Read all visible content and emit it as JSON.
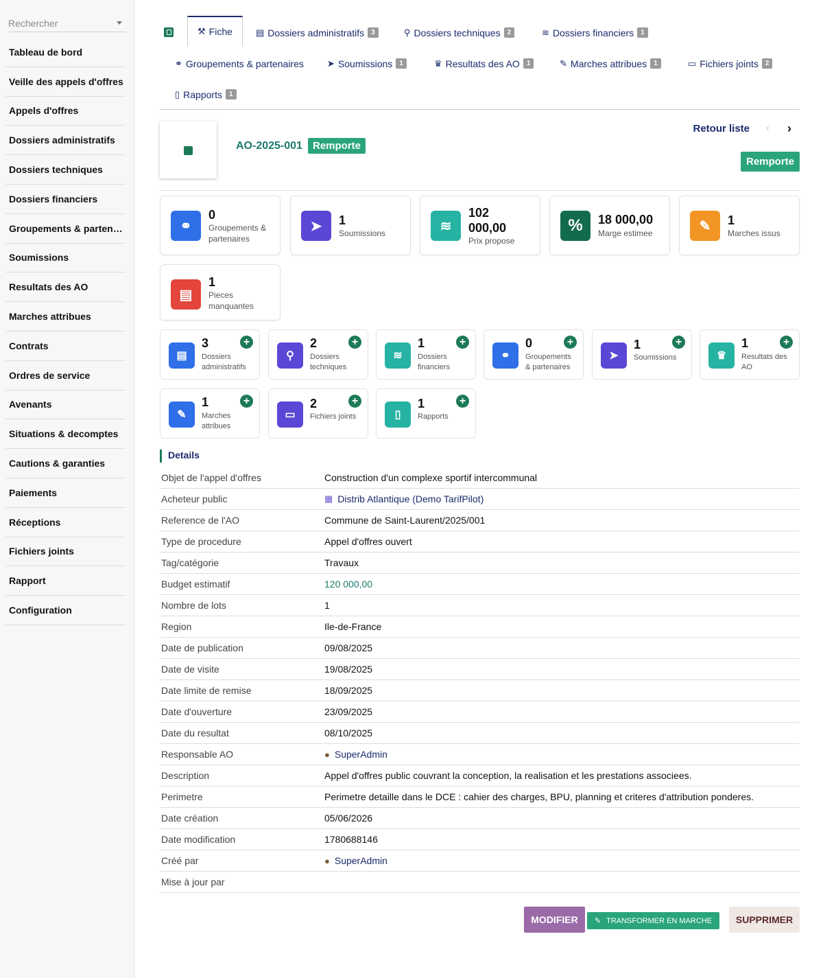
{
  "sidebar": {
    "search_placeholder": "Rechercher",
    "items": [
      "Tableau de bord",
      "Veille des appels d'offres",
      "Appels d'offres",
      "Dossiers administratifs",
      "Dossiers techniques",
      "Dossiers financiers",
      "Groupements & partenaires",
      "Soumissions",
      "Resultats des AO",
      "Marches attribues",
      "Contrats",
      "Ordres de service",
      "Avenants",
      "Situations & decomptes",
      "Cautions & garanties",
      "Paiements",
      "Réceptions",
      "Fichiers joints",
      "Rapport",
      "Configuration"
    ]
  },
  "tabs": [
    {
      "label": "Fiche",
      "icon": "wrench-icon",
      "badge": ""
    },
    {
      "label": "Dossiers administratifs",
      "icon": "id-card-icon",
      "badge": "3"
    },
    {
      "label": "Dossiers techniques",
      "icon": "compass-icon",
      "badge": "2"
    },
    {
      "label": "Dossiers financiers",
      "icon": "coins-icon",
      "badge": "1"
    },
    {
      "label": "Groupements & partenaires",
      "icon": "handshake-icon",
      "badge": ""
    },
    {
      "label": "Soumissions",
      "icon": "paper-plane-icon",
      "badge": "1"
    },
    {
      "label": "Resultats des AO",
      "icon": "trophy-icon",
      "badge": "1"
    },
    {
      "label": "Marches attribues",
      "icon": "signature-icon",
      "badge": "1"
    },
    {
      "label": "Fichiers joints",
      "icon": "folder-open-icon",
      "badge": "2"
    },
    {
      "label": "Rapports",
      "icon": "file-icon",
      "badge": "1"
    }
  ],
  "header": {
    "ref": "AO-2025-001",
    "status": "Remporte",
    "back_label": "Retour liste",
    "prev": "‹",
    "next": "›",
    "status_button": "Remporte"
  },
  "stats": [
    {
      "value": "0",
      "label_1": "Groupements &",
      "label_2": "partenaires",
      "icon": "handshake-icon",
      "color": "#2f6fe8"
    },
    {
      "value": "1",
      "label_1": "Soumissions",
      "label_2": "",
      "icon": "paper-plane-icon",
      "color": "#5b47d6"
    },
    {
      "value": "102 000,00",
      "label_1": "Prix propose",
      "label_2": "",
      "icon": "coins-icon",
      "color": "#26b3a3"
    },
    {
      "value": "18 000,00",
      "label_1": "Marge estimee",
      "label_2": "",
      "icon": "percent-icon",
      "color": "#136b4e"
    },
    {
      "value": "1",
      "label_1": "Marches issus",
      "label_2": "",
      "icon": "signature-icon",
      "color": "#f29524"
    },
    {
      "value": "1",
      "label_1": "Pieces",
      "label_2": "manquantes",
      "icon": "id-card-icon",
      "color": "#e3453c"
    }
  ],
  "mini_cards": [
    {
      "value": "3",
      "label_1": "Dossiers",
      "label_2": "administratifs",
      "icon": "id-card-icon",
      "color": "#2f6fe8"
    },
    {
      "value": "2",
      "label_1": "Dossiers",
      "label_2": "techniques",
      "icon": "compass-icon",
      "color": "#5b47d6"
    },
    {
      "value": "1",
      "label_1": "Dossiers",
      "label_2": "financiers",
      "icon": "coins-icon",
      "color": "#26b3a3"
    },
    {
      "value": "0",
      "label_1": "Groupements",
      "label_2": "& partenaires",
      "icon": "handshake-icon",
      "color": "#2f6fe8"
    },
    {
      "value": "1",
      "label_1": "Soumissions",
      "label_2": "",
      "icon": "paper-plane-icon",
      "color": "#5b47d6"
    },
    {
      "value": "1",
      "label_1": "Resultats des",
      "label_2": "AO",
      "icon": "trophy-icon",
      "color": "#26b3a3"
    },
    {
      "value": "1",
      "label_1": "Marches",
      "label_2": "attribues",
      "icon": "signature-icon",
      "color": "#2f6fe8"
    },
    {
      "value": "2",
      "label_1": "Fichiers joints",
      "label_2": "",
      "icon": "folder-open-icon",
      "color": "#5b47d6"
    },
    {
      "value": "1",
      "label_1": "Rapports",
      "label_2": "",
      "icon": "file-icon",
      "color": "#26b3a3"
    }
  ],
  "details": {
    "title": "Details",
    "rows": [
      {
        "k": "Objet de l'appel d'offres",
        "v": "Construction d'un complexe sportif intercommunal"
      },
      {
        "k": "Acheteur public",
        "v": "Distrib Atlantique (Demo TarifPilot)"
      },
      {
        "k": "Reference de l'AO",
        "v": "Commune de Saint-Laurent/2025/001"
      },
      {
        "k": "Type de procedure",
        "v": "Appel d'offres ouvert"
      },
      {
        "k": "Tag/catégorie",
        "v": "Travaux"
      },
      {
        "k": "Budget estimatif",
        "v": "120 000,00"
      },
      {
        "k": "Nombre de lots",
        "v": "1"
      },
      {
        "k": "Region",
        "v": "Ile-de-France"
      },
      {
        "k": "Date de publication",
        "v": "09/08/2025"
      },
      {
        "k": "Date de visite",
        "v": "19/08/2025"
      },
      {
        "k": "Date limite de remise",
        "v": "18/09/2025"
      },
      {
        "k": "Date d'ouverture",
        "v": "23/09/2025"
      },
      {
        "k": "Date du resultat",
        "v": "08/10/2025"
      },
      {
        "k": "Responsable AO",
        "v": "SuperAdmin"
      },
      {
        "k": "Description",
        "v": "Appel d'offres public couvrant la conception, la realisation et les prestations associees."
      },
      {
        "k": "Perimetre",
        "v": "Perimetre detaille dans le DCE : cahier des charges, BPU, planning et criteres d'attribution ponderes."
      },
      {
        "k": "Date création",
        "v": "05/06/2026"
      },
      {
        "k": "Date modification",
        "v": "1780688146"
      },
      {
        "k": "Créé par",
        "v": "SuperAdmin"
      },
      {
        "k": "Mise à jour par",
        "v": ""
      }
    ]
  },
  "actions": {
    "modify": "MODIFIER",
    "transform": "TRANSFORMER EN MARCHE",
    "delete": "SUPPRIMER"
  }
}
